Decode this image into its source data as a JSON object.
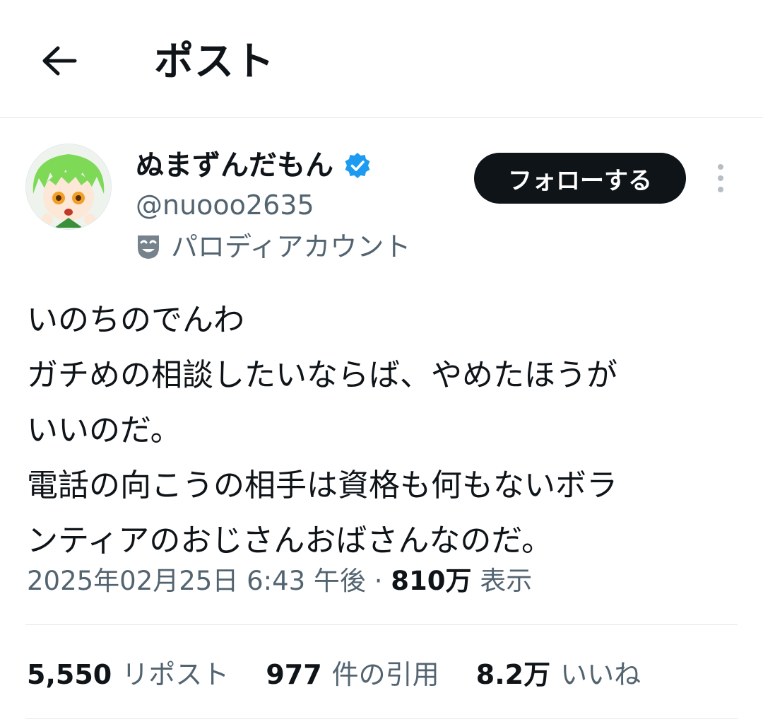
{
  "header": {
    "title": "ポスト",
    "back_icon": "arrow-left-icon"
  },
  "author": {
    "display_name": "ぬまずんだもん",
    "handle": "@nuooo2635",
    "verified": true,
    "verified_color": "#1d9bf0",
    "account_label": "パロディアカウント",
    "label_icon": "theater-mask-icon"
  },
  "actions": {
    "follow_label": "フォローする",
    "more_icon": "vertical-dots-icon"
  },
  "post": {
    "text": "いのちのでんわ\nガチめの相談したいならば、やめたほうが\nいいのだ。\n電話の向こうの相手は資格も何もないボラ\nンティアのおじさんおばさんなのだ。",
    "timestamp": "2025年02月25日 6:43 午後",
    "separator": "·",
    "views_count": "810万",
    "views_label": "表示"
  },
  "stats": [
    {
      "count": "5,550",
      "label": "リポスト"
    },
    {
      "count": "977",
      "label": "件の引用"
    },
    {
      "count": "8.2万",
      "label": "いいね"
    }
  ]
}
